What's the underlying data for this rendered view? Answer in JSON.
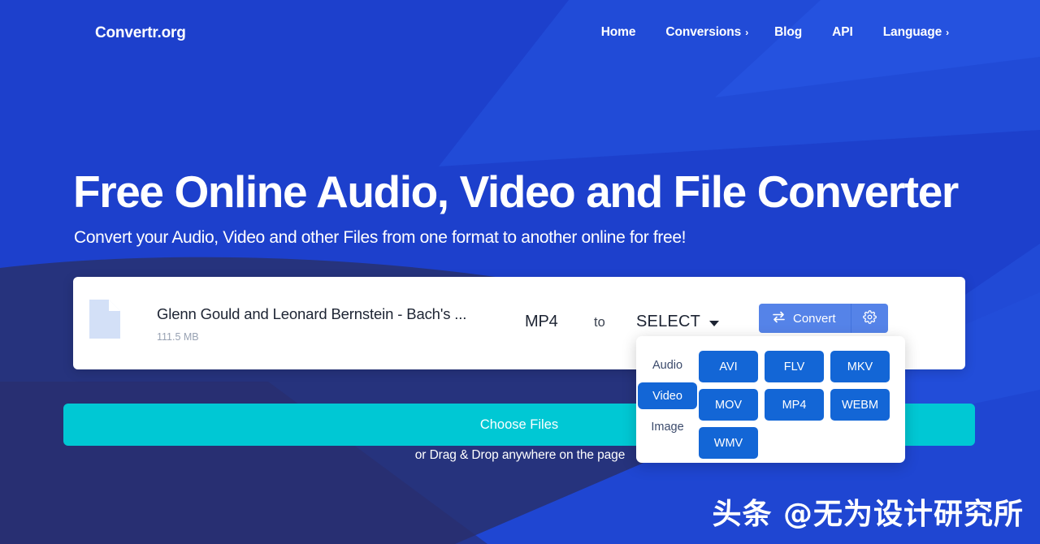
{
  "header": {
    "logo": "Convertr.org",
    "nav": [
      {
        "label": "Home",
        "chevron": ""
      },
      {
        "label": "Conversions",
        "chevron": "›"
      },
      {
        "label": "Blog",
        "chevron": ""
      },
      {
        "label": "API",
        "chevron": ""
      },
      {
        "label": "Language",
        "chevron": "›"
      }
    ]
  },
  "hero": {
    "title": "Free Online Audio, Video and File Converter",
    "subtitle": "Convert your Audio, Video and other Files from one format to another online for free!"
  },
  "file_card": {
    "icon": "document-icon",
    "file_name": "Glenn Gould and Leonard Bernstein - Bach's ...",
    "file_size": "111.5 MB",
    "source_format": "MP4",
    "to_label": "to",
    "target_format": "SELECT",
    "convert_label": "Convert",
    "convert_icon": "swap-arrows-icon",
    "settings_icon": "gear-icon"
  },
  "dropdown": {
    "categories": [
      {
        "label": "Audio",
        "active": false
      },
      {
        "label": "Video",
        "active": true
      },
      {
        "label": "Image",
        "active": false
      }
    ],
    "formats": [
      "AVI",
      "FLV",
      "MKV",
      "MOV",
      "MP4",
      "WEBM",
      "WMV"
    ]
  },
  "upload": {
    "choose_files_label": "Choose Files",
    "drag_hint": "or Drag & Drop anywhere on the page"
  },
  "watermark": "头条 @无为设计研究所",
  "colors": {
    "background_blue": "#1d40cc",
    "background_navy": "#2a2d6b",
    "accent_cyan": "#00c8d4",
    "format_blue": "#1366d6",
    "convert_blue": "#5583e8"
  }
}
